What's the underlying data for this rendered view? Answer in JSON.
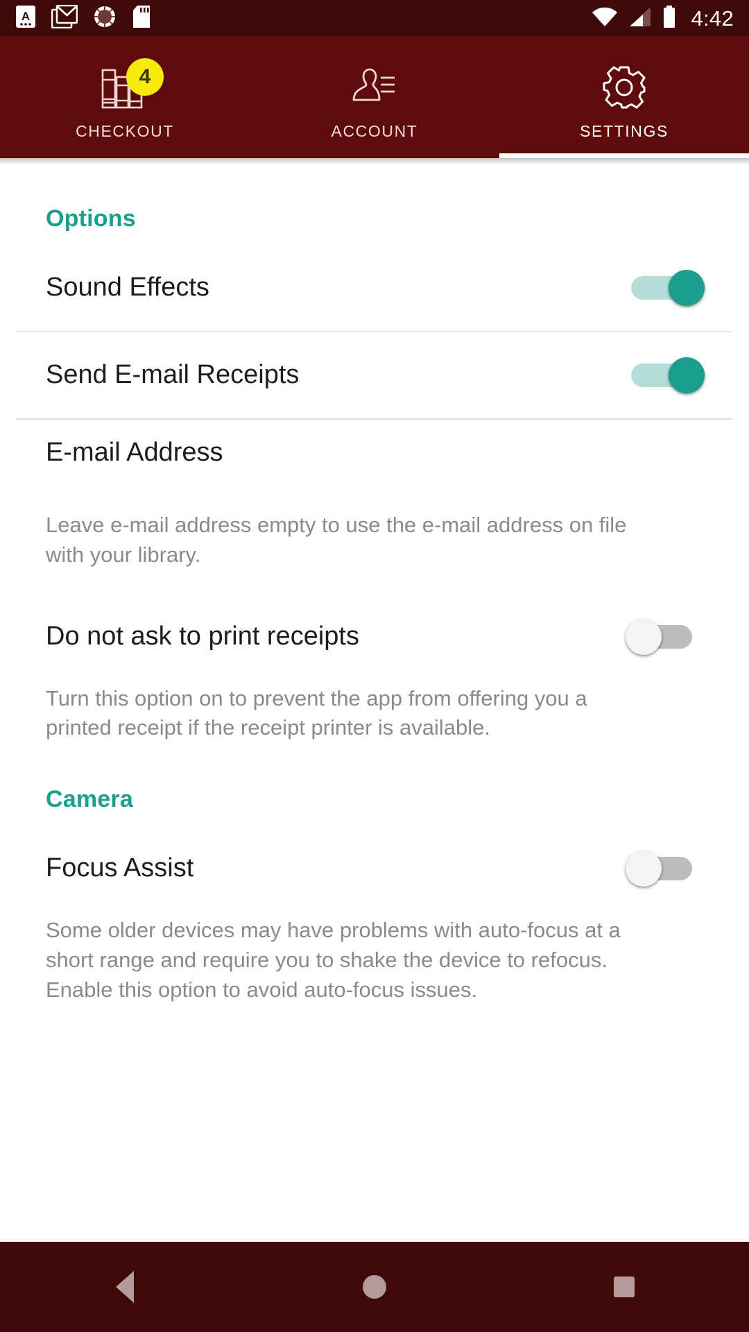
{
  "status_bar": {
    "notification_icons": [
      "app-letter-a-icon",
      "gmail-icon",
      "sync-progress-icon",
      "sd-card-icon"
    ],
    "wifi_icon": "wifi-icon",
    "signal_icon": "cell-signal-icon",
    "battery_icon": "battery-full-icon",
    "time": "4:42",
    "background_color": "#3d0a08"
  },
  "tabs": {
    "background_color": "#5e0b0b",
    "indicator_color": "#ffffff",
    "items": [
      {
        "label": "CHECKOUT",
        "icon": "books-icon",
        "badge": "4",
        "badge_color": "#f5ea0a",
        "active": false
      },
      {
        "label": "ACCOUNT",
        "icon": "contact-person-icon",
        "badge": null,
        "active": false
      },
      {
        "label": "SETTINGS",
        "icon": "gear-icon",
        "badge": null,
        "active": true
      }
    ]
  },
  "settings": {
    "accent_color": "#18a08c",
    "sections": [
      {
        "header": "Options",
        "rows": [
          {
            "label": "Sound Effects",
            "toggle": "on"
          },
          {
            "label": "Send E-mail Receipts",
            "toggle": "on"
          }
        ],
        "email": {
          "label": "E-mail Address",
          "value": "",
          "placeholder": "",
          "helper": "Leave e-mail address empty to use the e-mail address on file with your library."
        },
        "print": {
          "label": "Do not ask to print receipts",
          "toggle": "off",
          "helper": "Turn this option on to prevent the app from offering you a printed receipt if the receipt printer is available."
        }
      },
      {
        "header": "Camera",
        "focus": {
          "label": "Focus Assist",
          "toggle": "off",
          "helper": "Some older devices may have problems with auto-focus at a short range and require you to shake the device to refocus. Enable this option to avoid auto-focus issues."
        }
      }
    ]
  },
  "nav_bar": {
    "background_color": "#3d0a08",
    "buttons": [
      "back-icon",
      "home-icon",
      "recents-icon"
    ]
  }
}
